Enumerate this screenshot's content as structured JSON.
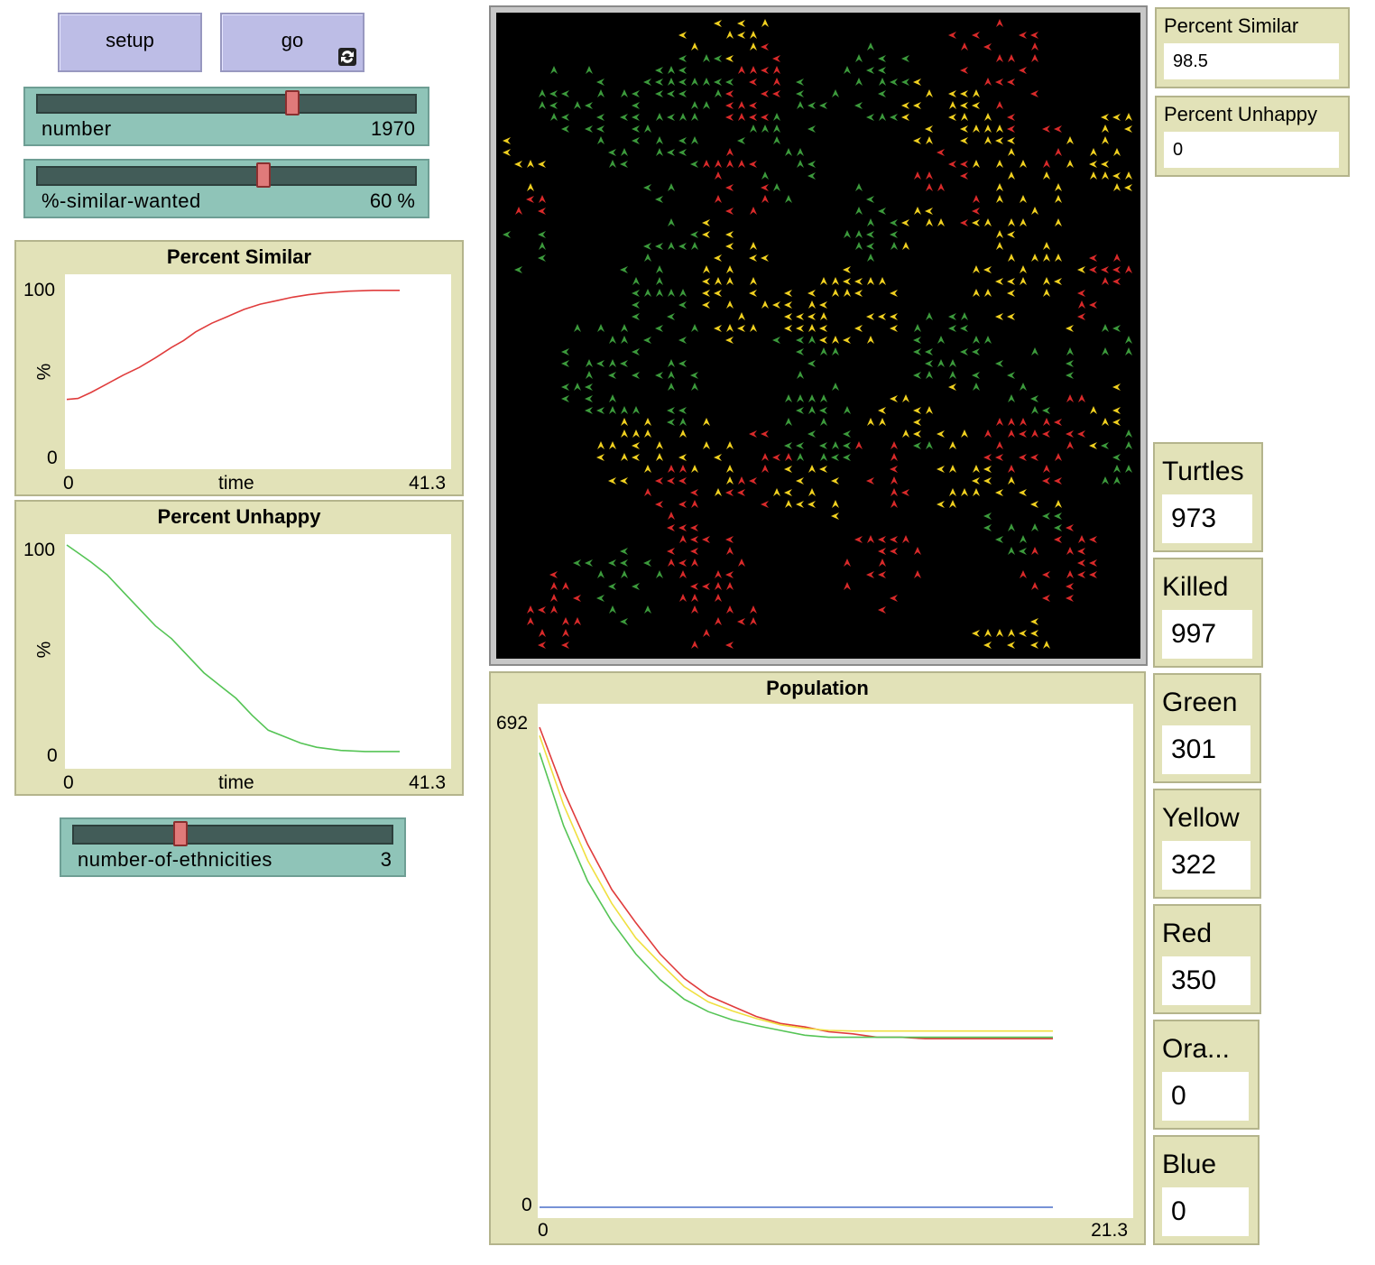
{
  "buttons": {
    "setup": "setup",
    "go": "go"
  },
  "sliders": {
    "number": {
      "label": "number",
      "value": "1970",
      "fraction": 0.68
    },
    "similar": {
      "label": "%-similar-wanted",
      "value": "60 %",
      "fraction": 0.6
    },
    "ethnicities": {
      "label": "number-of-ethnicities",
      "value": "3",
      "fraction": 0.33
    }
  },
  "plots": {
    "similar": {
      "title": "Percent Similar",
      "ymin": "0",
      "ymax": "100",
      "ylabel": "%",
      "xmin": "0",
      "xlabel": "time",
      "xmax": "41.3",
      "color": "#e03c3c"
    },
    "unhappy": {
      "title": "Percent Unhappy",
      "ymin": "0",
      "ymax": "100",
      "ylabel": "%",
      "xmin": "0",
      "xlabel": "time",
      "xmax": "41.3",
      "color": "#55c455"
    },
    "population": {
      "title": "Population",
      "ymin": "0",
      "ymax": "692",
      "xmin": "0",
      "xmax": "21.3"
    }
  },
  "monitors": {
    "similar": {
      "label": "Percent Similar",
      "value": "98.5"
    },
    "unhappy": {
      "label": "Percent Unhappy",
      "value": "0"
    },
    "turtles": {
      "label": "Turtles",
      "value": "973"
    },
    "killed": {
      "label": "Killed",
      "value": "997"
    },
    "green": {
      "label": "Green",
      "value": "301"
    },
    "yellow": {
      "label": "Yellow",
      "value": "322"
    },
    "red": {
      "label": "Red",
      "value": "350"
    },
    "orange": {
      "label": "Ora...",
      "value": "0"
    },
    "blue": {
      "label": "Blue",
      "value": "0"
    }
  },
  "world": {
    "colors": [
      "#d82a2a",
      "#f0d020",
      "#3c9a3c"
    ]
  },
  "chart_data": [
    {
      "type": "line",
      "title": "Percent Similar",
      "xlabel": "time",
      "ylabel": "%",
      "xlim": [
        0,
        41.3
      ],
      "ylim": [
        0,
        100
      ],
      "series": [
        {
          "color": "#e03c3c",
          "x": [
            0,
            1.4,
            3,
            5,
            7,
            9,
            11,
            13,
            14.5,
            16,
            18,
            20,
            22,
            24,
            26,
            28,
            30,
            32,
            35,
            38,
            41.3
          ],
          "y": [
            34,
            34.6,
            38,
            43,
            48,
            52.5,
            58,
            64,
            68,
            73,
            78,
            82,
            86,
            89,
            91,
            93,
            94.5,
            95.5,
            96.5,
            97,
            97
          ]
        }
      ]
    },
    {
      "type": "line",
      "title": "Percent Unhappy",
      "xlabel": "time",
      "ylabel": "%",
      "xlim": [
        0,
        41.3
      ],
      "ylim": [
        0,
        100
      ],
      "series": [
        {
          "color": "#55c455",
          "x": [
            0,
            1.5,
            3,
            5,
            7,
            9,
            11,
            13,
            15,
            17,
            19,
            21,
            23,
            25,
            27,
            29,
            31,
            34,
            37,
            41.3
          ],
          "y": [
            100,
            96,
            92,
            86,
            78,
            70,
            62,
            56,
            48,
            40,
            34,
            28,
            20,
            13,
            10,
            7,
            5,
            3.5,
            3,
            3
          ]
        }
      ]
    },
    {
      "type": "line",
      "title": "Population",
      "xlim": [
        0,
        21.3
      ],
      "ylim": [
        0,
        692
      ],
      "series": [
        {
          "color": "#e03c3c",
          "x": [
            0,
            1,
            2,
            3,
            4,
            5,
            6,
            7,
            8,
            9,
            10,
            11,
            12,
            13,
            14,
            15,
            16,
            17,
            18,
            19,
            20,
            21.3
          ],
          "y": [
            692,
            600,
            523,
            458,
            410,
            365,
            330,
            305,
            290,
            275,
            265,
            260,
            253,
            250,
            245,
            245,
            243,
            243,
            243,
            243,
            243,
            243
          ]
        },
        {
          "color": "#f0e040",
          "x": [
            0,
            1,
            2,
            3,
            4,
            5,
            6,
            7,
            8,
            9,
            10,
            11,
            12,
            13,
            14,
            15,
            16,
            17,
            18,
            19,
            20,
            21.3
          ],
          "y": [
            680,
            580,
            500,
            438,
            388,
            352,
            318,
            296,
            283,
            272,
            263,
            258,
            255,
            254,
            254,
            254,
            254,
            254,
            254,
            254,
            254,
            254
          ]
        },
        {
          "color": "#55c455",
          "x": [
            0,
            1,
            2,
            3,
            4,
            5,
            6,
            7,
            8,
            9,
            10,
            11,
            12,
            13,
            14,
            15,
            16,
            17,
            18,
            19,
            20,
            21.3
          ],
          "y": [
            655,
            550,
            470,
            412,
            365,
            328,
            300,
            282,
            270,
            262,
            255,
            248,
            245,
            245,
            245,
            245,
            245,
            245,
            245,
            245,
            245,
            245
          ]
        },
        {
          "color": "#4a6fc8",
          "x": [
            0,
            21.3
          ],
          "y": [
            0,
            0
          ]
        }
      ]
    }
  ]
}
